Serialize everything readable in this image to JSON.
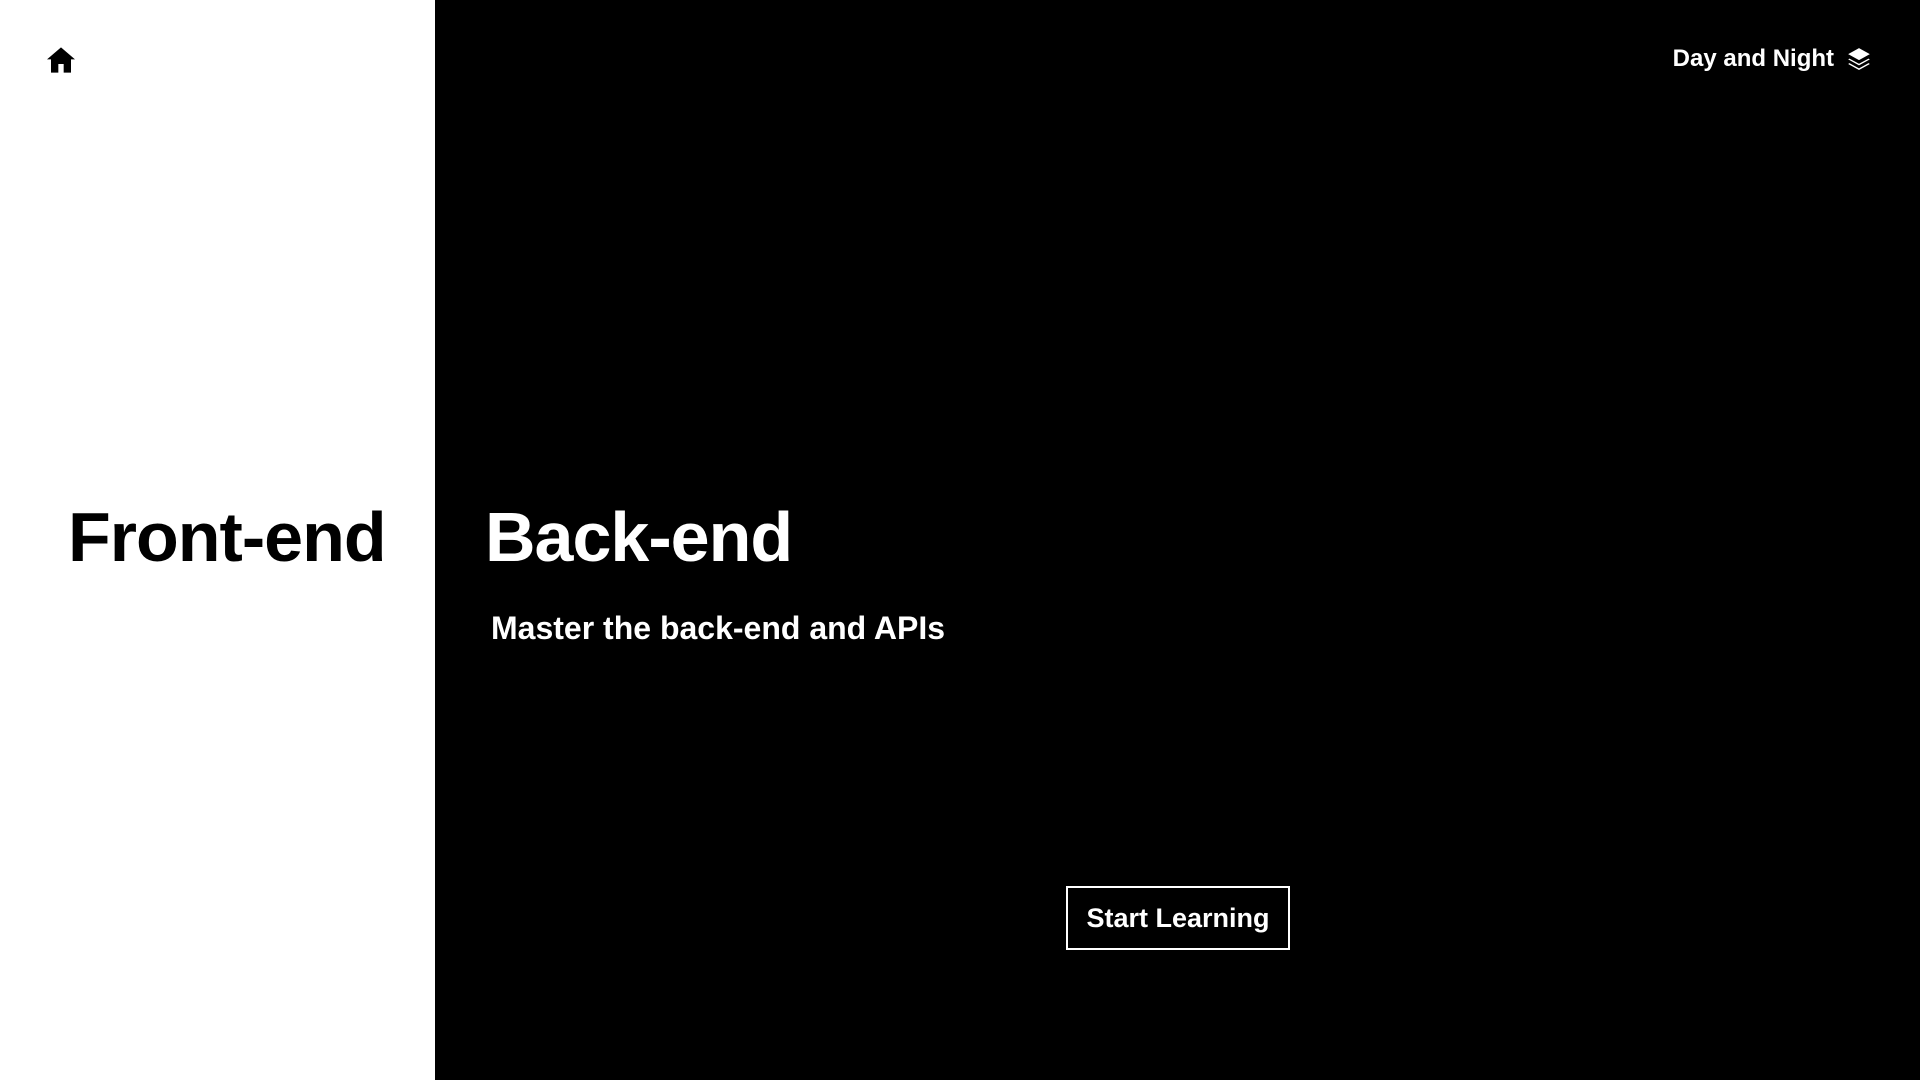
{
  "colors": {
    "front_background": "#ffffff",
    "front_text": "#000000",
    "back_background": "#000000",
    "back_text": "#ffffff"
  },
  "header": {
    "home_icon": "home-icon",
    "theme_toggle_label": "Day and Night",
    "theme_toggle_icon": "layers-icon"
  },
  "front": {
    "title": "Front-end"
  },
  "back": {
    "title": "Back-end",
    "subtitle": "Master the back-end and APIs",
    "cta_label": "Start Learning"
  }
}
